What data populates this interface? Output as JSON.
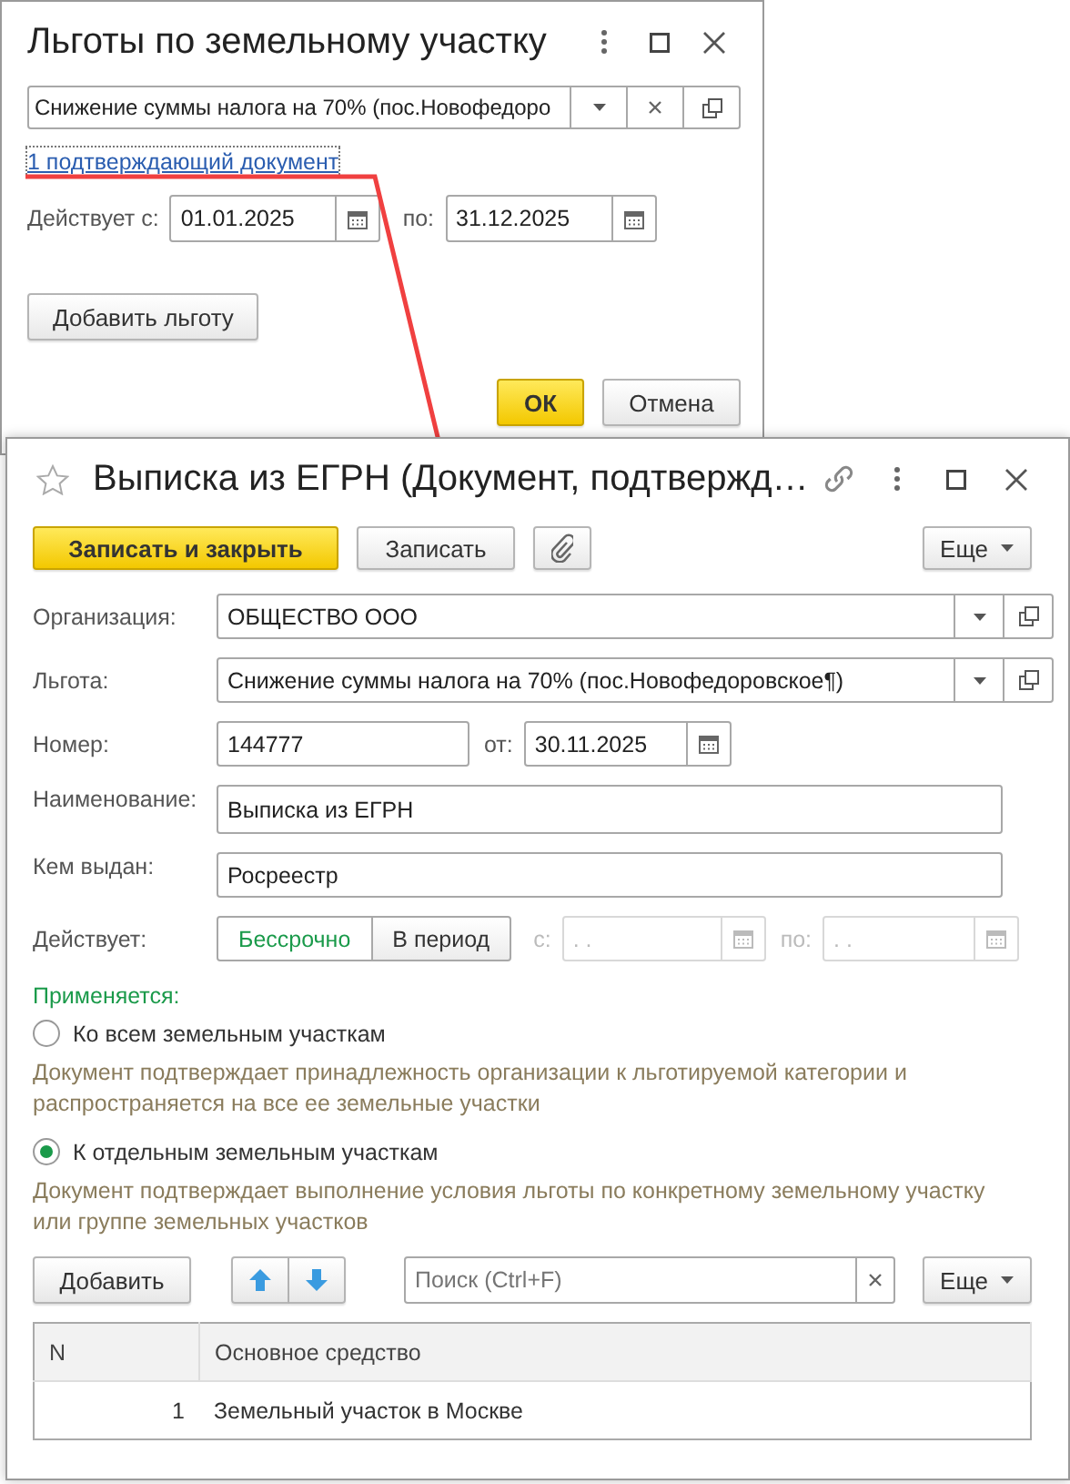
{
  "benefit_window": {
    "title": "Льготы по земельному участку",
    "benefit": {
      "value": "Снижение суммы налога на 70% (пос.Новофедоро"
    },
    "link": "1 подтверждающий документ",
    "valid_from": {
      "label": "Действует с:",
      "value": "01.01.2025"
    },
    "valid_to": {
      "label": "по:",
      "value": "31.12.2025"
    },
    "add_button": "Добавить льготу",
    "buttons": [
      {
        "label": "ОК",
        "kind": "default"
      },
      {
        "label": "Отмена",
        "kind": "normal"
      }
    ]
  },
  "document_window": {
    "title": "Выписка из ЕГРН (Документ, подтвержд…",
    "toolbar": {
      "save_close": "Записать и закрыть",
      "save": "Записать",
      "more": "Еще"
    },
    "fields": [
      {
        "kind": "select",
        "label": "Организация:",
        "value": "ОБЩЕСТВО ООО"
      },
      {
        "kind": "select",
        "label": "Льгота:",
        "value": "Снижение суммы налога на 70% (пос.Новофедоровское¶)"
      },
      {
        "kind": "number_date",
        "label": "Номер:",
        "value": "144777",
        "date_label": "от:",
        "date": "30.11.2025"
      },
      {
        "kind": "text",
        "label": "Наименование:",
        "value": "Выписка из ЕГРН"
      },
      {
        "kind": "text",
        "label": "Кем выдан:",
        "value": "Росреестр"
      }
    ],
    "validity": {
      "label": "Действует:",
      "options": [
        {
          "label": "Бессрочно",
          "selected": true
        },
        {
          "label": "В период",
          "selected": false
        }
      ],
      "from": {
        "label": "с:",
        "placeholder": " .  . ",
        "disabled": true
      },
      "to": {
        "label": "по:",
        "placeholder": " .  . ",
        "disabled": true
      }
    },
    "applies": {
      "label": "Применяется:",
      "options": [
        {
          "label": "Ко всем земельным участкам",
          "selected": false,
          "description": "Документ подтверждает принадлежность организации к льготируемой категории и распространяется на все ее земельные участки"
        },
        {
          "label": "К отдельным земельным участкам",
          "selected": true,
          "description": "Документ подтверждает выполнение условия льготы по конкретному земельному участку или группе земельных участков"
        }
      ]
    },
    "table_toolbar": {
      "add": "Добавить",
      "search_placeholder": "Поиск (Ctrl+F)",
      "more": "Еще"
    },
    "table": {
      "columns": [
        "N",
        "Основное средство"
      ],
      "rows": [
        {
          "n": "1",
          "asset": "Земельный участок в Москве"
        }
      ]
    }
  }
}
